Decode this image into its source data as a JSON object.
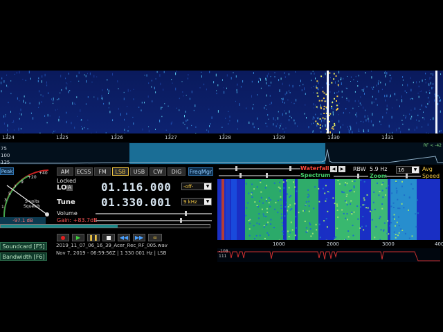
{
  "main_axis": {
    "ticks": [
      "1324",
      "1325",
      "1326",
      "1327",
      "1328",
      "1329",
      "1330",
      "1331"
    ]
  },
  "spectrum_strip": {
    "y_labels": [
      "75",
      "100",
      "125"
    ],
    "rf_label": "RF < -42"
  },
  "smeter": {
    "peak_label": "Peak",
    "scale_labels": [
      "+40",
      "+20",
      "9",
      "7",
      "5",
      "3",
      "1"
    ],
    "units_label": "S-units",
    "squelch_label": "Squelch",
    "level": "-97.1 dB"
  },
  "modes": {
    "items": [
      "AM",
      "ECSS",
      "FM",
      "LSB",
      "USB",
      "CW",
      "DIG"
    ],
    "selected": "LSB",
    "freqmgr_label": "FreqMgr"
  },
  "lo": {
    "locked_label": "Locked",
    "lo_label": "LO",
    "a_badge": "A",
    "value": "01.116.000",
    "offset_value": "-off-"
  },
  "tune": {
    "label": "Tune",
    "value": "01.330.001",
    "bw_value": "9 kHz"
  },
  "volume": {
    "label": "Volume",
    "level": 0.78
  },
  "gain": {
    "label": "Gain: +83.7dB",
    "level": 0.74
  },
  "side_buttons": {
    "soundcard": "Soundcard [F5]",
    "bandwidth": "Bandwidth [F6]"
  },
  "recording": {
    "filename": "2019_11_07_06_16_39_Acer_Rec_RF_005.wav",
    "status": "Nov 7, 2019 - 06:59:56Z | 1 330 001 Hz | LSB"
  },
  "transport": {
    "record_icon": "record-icon",
    "play_icon": "play-icon",
    "pause_icon": "pause-icon",
    "stop_icon": "stop-icon",
    "rewind_icon": "rewind-icon",
    "forward_icon": "fast-forward-icon",
    "loop_icon": "loop-icon"
  },
  "right_panel": {
    "waterfall_label": "Waterfall",
    "spectrum_label": "Spectrum",
    "rbw_label": "RBW",
    "rbw_value": "5.9 Hz",
    "avg_value": "16",
    "avg_label": "Avg",
    "speed_label": "Speed",
    "zoom_label": "Zoom",
    "axis_ticks": [
      "1000",
      "2000",
      "3000",
      "400"
    ],
    "spec_y_labels": [
      "-108",
      "111"
    ]
  },
  "colors": {
    "accent_yellow": "#f2c744",
    "waterfall_label": "#ff4a3d",
    "spectrum_label": "#44d06a",
    "passband": "#1a6e96"
  }
}
